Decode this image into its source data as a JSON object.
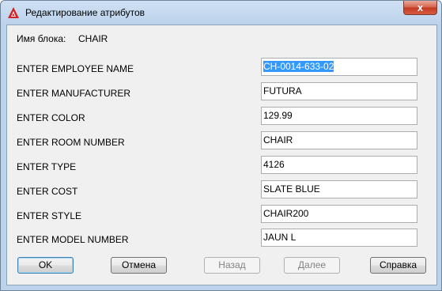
{
  "window": {
    "title": "Редактирование атрибутов",
    "close_glyph": "x"
  },
  "block": {
    "label": "Имя блока:",
    "value": "CHAIR"
  },
  "attributes": [
    {
      "label": "ENTER EMPLOYEE NAME",
      "value": "CH-0014-633-02",
      "selected": true
    },
    {
      "label": "ENTER MANUFACTURER",
      "value": "FUTURA"
    },
    {
      "label": "ENTER COLOR",
      "value": "129.99"
    },
    {
      "label": "ENTER ROOM NUMBER",
      "value": "CHAIR"
    },
    {
      "label": "ENTER TYPE",
      "value": "4126"
    },
    {
      "label": "ENTER COST",
      "value": "SLATE BLUE"
    },
    {
      "label": "ENTER STYLE",
      "value": "CHAIR200"
    },
    {
      "label": "ENTER MODEL NUMBER",
      "value": "JAUN L"
    }
  ],
  "buttons": {
    "ok": "OK",
    "cancel": "Отмена",
    "back": "Назад",
    "next": "Далее",
    "help": "Справка"
  },
  "colors": {
    "selection": "#3399ff",
    "app_icon": "#d22222",
    "close_button": "#c7452f"
  }
}
